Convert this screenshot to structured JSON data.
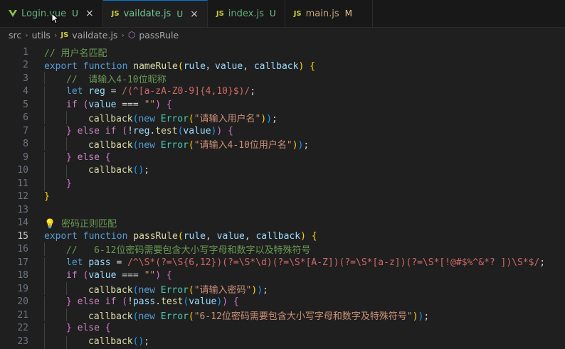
{
  "tabs": [
    {
      "icon": "vue-icon",
      "label": "Login.vue",
      "badge": "U",
      "state": "untracked",
      "active": false,
      "close": "×"
    },
    {
      "icon": "js-icon",
      "lang": "JS",
      "label": "vaildate.js",
      "badge": "U",
      "state": "untracked",
      "active": true,
      "close": "×"
    },
    {
      "icon": "js-icon",
      "lang": "JS",
      "label": "index.js",
      "badge": "U",
      "state": "untracked",
      "active": false
    },
    {
      "icon": "js-icon",
      "lang": "JS",
      "label": "main.js",
      "badge": "M",
      "state": "modified",
      "active": false
    }
  ],
  "breadcrumb": {
    "items": [
      "src",
      "utils",
      "vaildate.js",
      "passRule"
    ],
    "js_lang": "JS"
  },
  "editor": {
    "current_line": 15,
    "lines": [
      {
        "n": "1",
        "tokens": [
          [
            "cmt",
            "// 用户名匹配"
          ]
        ]
      },
      {
        "n": "2",
        "tokens": [
          [
            "kw",
            "export "
          ],
          [
            "kw",
            "function "
          ],
          [
            "fn",
            "nameRule"
          ],
          [
            "pn",
            "("
          ],
          [
            "var",
            "rule"
          ],
          [
            "",
            "，"
          ],
          [
            "var",
            "value"
          ],
          [
            "",
            ", "
          ],
          [
            "var",
            "callback"
          ],
          [
            "pn",
            ")"
          ],
          [
            "",
            " "
          ],
          [
            "pn",
            "{"
          ]
        ]
      },
      {
        "n": "3",
        "indent": 1,
        "tokens": [
          [
            "cmt",
            "//  请输入4-10位昵称"
          ]
        ]
      },
      {
        "n": "4",
        "indent": 1,
        "tokens": [
          [
            "kw",
            "let "
          ],
          [
            "var",
            "reg"
          ],
          [
            "",
            " = "
          ],
          [
            "re",
            "/(^[a-zA-Z0-9]{4,10}$)/"
          ],
          [
            "",
            ";"
          ]
        ]
      },
      {
        "n": "5",
        "indent": 1,
        "tokens": [
          [
            "kw2",
            "if "
          ],
          [
            "pn2",
            "("
          ],
          [
            "var",
            "value"
          ],
          [
            "",
            " === "
          ],
          [
            "str",
            "\"\""
          ],
          [
            "pn2",
            ")"
          ],
          [
            "",
            " "
          ],
          [
            "pn2",
            "{"
          ]
        ]
      },
      {
        "n": "6",
        "indent": 2,
        "tokens": [
          [
            "fn",
            "callback"
          ],
          [
            "pn3",
            "("
          ],
          [
            "kw",
            "new "
          ],
          [
            "cls",
            "Error"
          ],
          [
            "pn",
            "("
          ],
          [
            "str",
            "\"请输入用户名\""
          ],
          [
            "pn",
            ")"
          ],
          [
            "pn3",
            ")"
          ],
          [
            "",
            ";"
          ]
        ]
      },
      {
        "n": "7",
        "indent": 1,
        "tokens": [
          [
            "pn2",
            "}"
          ],
          [
            "",
            " "
          ],
          [
            "kw2",
            "else if "
          ],
          [
            "pn2",
            "("
          ],
          [
            "",
            "!"
          ],
          [
            "var",
            "reg"
          ],
          [
            "",
            "."
          ],
          [
            "fn",
            "test"
          ],
          [
            "pn3",
            "("
          ],
          [
            "var",
            "value"
          ],
          [
            "pn3",
            ")"
          ],
          [
            "pn2",
            ")"
          ],
          [
            "",
            " "
          ],
          [
            "pn2",
            "{"
          ]
        ]
      },
      {
        "n": "8",
        "indent": 2,
        "tokens": [
          [
            "fn",
            "callback"
          ],
          [
            "pn3",
            "("
          ],
          [
            "kw",
            "new "
          ],
          [
            "cls",
            "Error"
          ],
          [
            "pn",
            "("
          ],
          [
            "str",
            "\"请输入4-10位用户名\""
          ],
          [
            "pn",
            ")"
          ],
          [
            "pn3",
            ")"
          ],
          [
            "",
            ";"
          ]
        ]
      },
      {
        "n": "9",
        "indent": 1,
        "tokens": [
          [
            "pn2",
            "}"
          ],
          [
            "",
            " "
          ],
          [
            "kw2",
            "else "
          ],
          [
            "pn2",
            "{"
          ]
        ]
      },
      {
        "n": "10",
        "indent": 2,
        "tokens": [
          [
            "fn",
            "callback"
          ],
          [
            "pn3",
            "()"
          ],
          [
            "",
            ";"
          ]
        ]
      },
      {
        "n": "11",
        "indent": 1,
        "tokens": [
          [
            "pn2",
            "}"
          ]
        ]
      },
      {
        "n": "12",
        "tokens": [
          [
            "pn",
            "}"
          ]
        ]
      },
      {
        "n": "13",
        "tokens": []
      },
      {
        "n": "14",
        "tokens": [
          [
            "bulb",
            "💡"
          ],
          [
            "cmt",
            " 密码正则匹配"
          ]
        ]
      },
      {
        "n": "15",
        "tokens": [
          [
            "kw",
            "export "
          ],
          [
            "kw",
            "function "
          ],
          [
            "fn",
            "passRule"
          ],
          [
            "pn",
            "("
          ],
          [
            "var",
            "rule"
          ],
          [
            "",
            ", "
          ],
          [
            "var",
            "value"
          ],
          [
            "",
            ", "
          ],
          [
            "var",
            "callback"
          ],
          [
            "pn",
            ")"
          ],
          [
            "",
            " "
          ],
          [
            "pn",
            "{"
          ]
        ]
      },
      {
        "n": "16",
        "indent": 1,
        "tokens": [
          [
            "cmt",
            "//   6-12位密码需要包含大小写字母和数字以及特殊符号"
          ]
        ]
      },
      {
        "n": "17",
        "indent": 1,
        "tokens": [
          [
            "kw",
            "let "
          ],
          [
            "var",
            "pass"
          ],
          [
            "",
            " = "
          ],
          [
            "re",
            "/^\\S*(?=\\S{6,12})(?=\\S*\\d)(?=\\S*[A-Z])(?=\\S*[a-z])(?=\\S*[!@#$%^&*? ])\\S*$/"
          ],
          [
            "",
            ";"
          ]
        ]
      },
      {
        "n": "18",
        "indent": 1,
        "tokens": [
          [
            "kw2",
            "if "
          ],
          [
            "pn2",
            "("
          ],
          [
            "var",
            "value"
          ],
          [
            "",
            " === "
          ],
          [
            "str",
            "\"\""
          ],
          [
            "pn2",
            ")"
          ],
          [
            "",
            " "
          ],
          [
            "pn2",
            "{"
          ]
        ]
      },
      {
        "n": "19",
        "indent": 2,
        "tokens": [
          [
            "fn",
            "callback"
          ],
          [
            "pn3",
            "("
          ],
          [
            "kw",
            "new "
          ],
          [
            "cls",
            "Error"
          ],
          [
            "pn",
            "("
          ],
          [
            "str",
            "\"请输入密码\""
          ],
          [
            "pn",
            ")"
          ],
          [
            "pn3",
            ")"
          ],
          [
            "",
            ";"
          ]
        ]
      },
      {
        "n": "20",
        "indent": 1,
        "tokens": [
          [
            "pn2",
            "}"
          ],
          [
            "",
            " "
          ],
          [
            "kw2",
            "else if "
          ],
          [
            "pn2",
            "("
          ],
          [
            "",
            "!"
          ],
          [
            "var",
            "pass"
          ],
          [
            "",
            "."
          ],
          [
            "fn",
            "test"
          ],
          [
            "pn3",
            "("
          ],
          [
            "var",
            "value"
          ],
          [
            "pn3",
            ")"
          ],
          [
            "pn2",
            ")"
          ],
          [
            "",
            " "
          ],
          [
            "pn2",
            "{"
          ]
        ]
      },
      {
        "n": "21",
        "indent": 2,
        "tokens": [
          [
            "fn",
            "callback"
          ],
          [
            "pn3",
            "("
          ],
          [
            "kw",
            "new "
          ],
          [
            "cls",
            "Error"
          ],
          [
            "pn",
            "("
          ],
          [
            "str",
            "\"6-12位密码需要包含大小写字母和数字及特殊符号\""
          ],
          [
            "pn",
            ")"
          ],
          [
            "pn3",
            ")"
          ],
          [
            "",
            ";"
          ]
        ]
      },
      {
        "n": "22",
        "indent": 1,
        "tokens": [
          [
            "pn2",
            "}"
          ],
          [
            "",
            " "
          ],
          [
            "kw2",
            "else "
          ],
          [
            "pn2",
            "{"
          ]
        ]
      },
      {
        "n": "23",
        "indent": 2,
        "tokens": [
          [
            "fn",
            "callback"
          ],
          [
            "pn3",
            "()"
          ],
          [
            "",
            ";"
          ]
        ]
      }
    ]
  }
}
